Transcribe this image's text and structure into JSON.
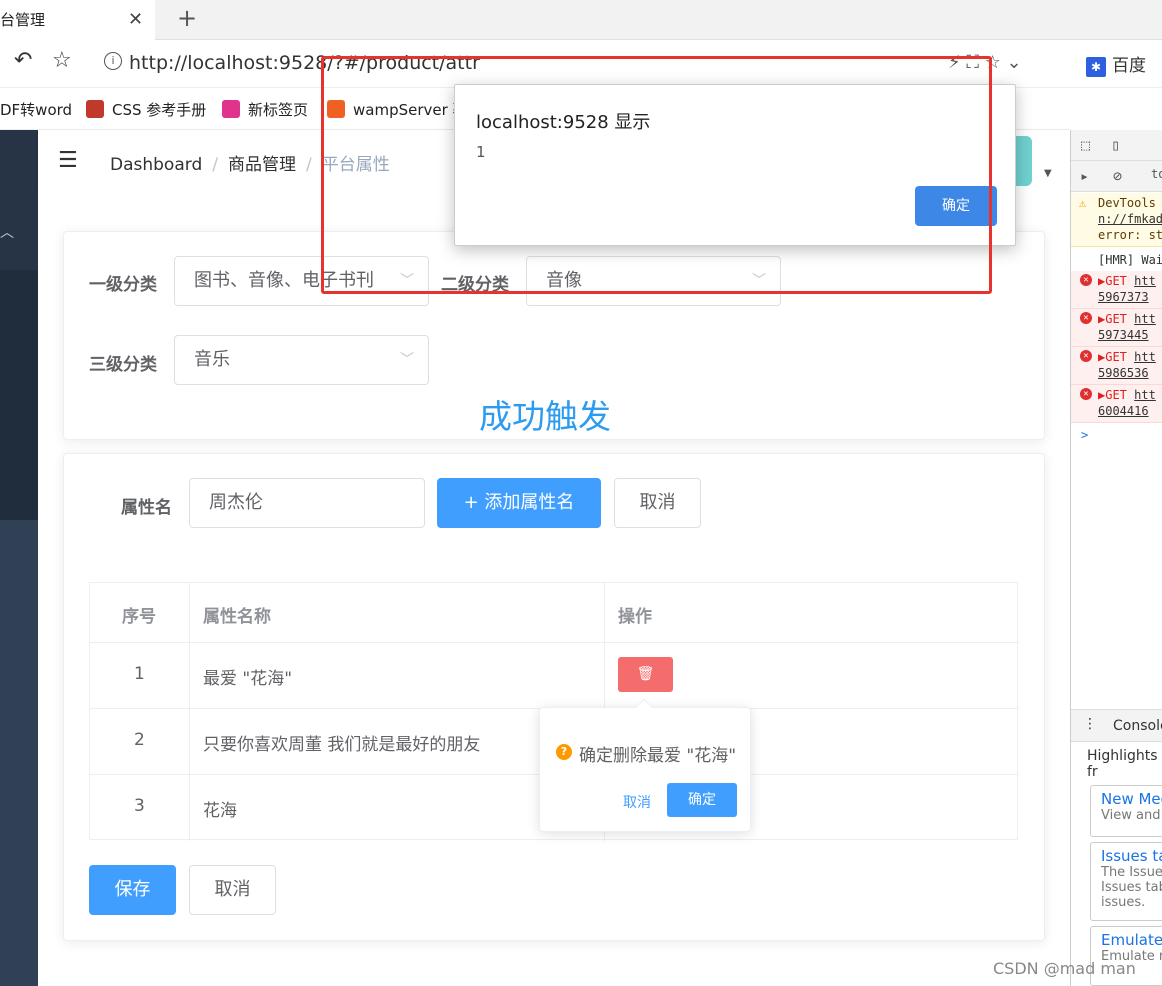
{
  "browser": {
    "tab_title": "台管理",
    "tab_close": "✕",
    "new_tab": "+",
    "url": "http://localhost:9528/?#/product/attr",
    "search_engine": "百度",
    "bookmarks": [
      "DF转word",
      "CSS 参考手册",
      "新标签页",
      "wampServer 覆"
    ]
  },
  "navbar": {
    "breadcrumb": [
      "Dashboard",
      "商品管理",
      "平台属性"
    ]
  },
  "category_card": {
    "level1_label": "一级分类",
    "level1_value": "图书、音像、电子书刊",
    "level2_label": "二级分类",
    "level2_value": "音像",
    "level3_label": "三级分类",
    "level3_value": "音乐",
    "success_text": "成功触发"
  },
  "attr_card": {
    "attr_name_label": "属性名",
    "attr_name_value": "周杰伦",
    "add_button": "+ 添加属性名",
    "cancel_button": "取消",
    "table_headers": [
      "序号",
      "属性名称",
      "操作"
    ],
    "rows": [
      {
        "index": "1",
        "name": "最爱 \"花海\""
      },
      {
        "index": "2",
        "name": "只要你喜欢周董 我们就是最好的朋友"
      },
      {
        "index": "3",
        "name": "花海"
      }
    ],
    "save_button": "保存",
    "cancel_button2": "取消"
  },
  "popconfirm": {
    "message": "确定删除最爱 \"花海\"",
    "cancel": "取消",
    "confirm": "确定"
  },
  "alert": {
    "title": "localhost:9528 显示",
    "message": "1",
    "ok": "确定"
  },
  "devtools": {
    "warning": [
      "DevTools",
      "n://fmkad",
      "error: st"
    ],
    "hmr": "[HMR] Wai",
    "errors": [
      {
        "method": "▶GET",
        "url": "htt",
        "id": "5967373"
      },
      {
        "method": "▶GET",
        "url": "htt",
        "id": "5973445"
      },
      {
        "method": "▶GET",
        "url": "htt",
        "id": "5986536"
      },
      {
        "method": "▶GET",
        "url": "htt",
        "id": "6004416"
      }
    ],
    "prompt": ">",
    "console_tab": "Console",
    "highlights": "Highlights fr",
    "cards": [
      {
        "title": "New Med",
        "desc": [
          "View and"
        ]
      },
      {
        "title": "Issues tal",
        "desc": [
          "The Issue",
          "Issues tab",
          "issues."
        ]
      },
      {
        "title": "Emulate",
        "desc": [
          "Emulate r"
        ]
      }
    ]
  },
  "watermark": "CSDN @mad man"
}
